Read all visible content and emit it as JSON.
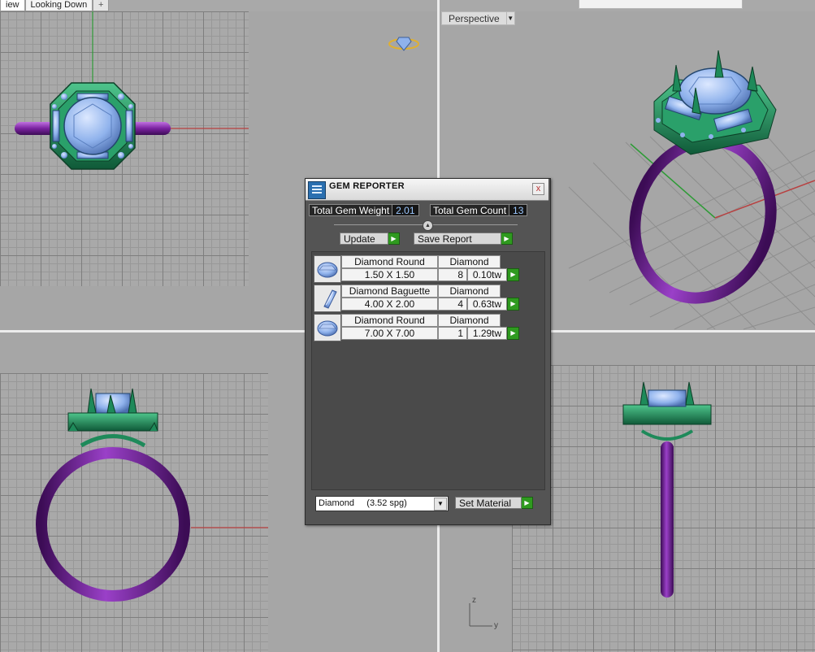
{
  "tabs": [
    {
      "label": "iew",
      "active": true
    },
    {
      "label": "Looking Down",
      "active": false
    }
  ],
  "add_tab_glyph": "+",
  "perspective_view": {
    "label": "Perspective",
    "dropdown_glyph": "▼"
  },
  "gem_reporter": {
    "title": "GEM REPORTER",
    "close_glyph": "x",
    "total_gem_weight": {
      "label": "Total Gem Weight",
      "value": "2.01"
    },
    "total_gem_count": {
      "label": "Total Gem Count",
      "value": "13"
    },
    "slider_glyph": "▲",
    "update_label": "Update",
    "save_report_label": "Save Report",
    "go_glyph": "▶",
    "gems": [
      {
        "shape": "Diamond Round",
        "size": "1.50 X 1.50",
        "material": "Diamond",
        "count": "8",
        "weight": "0.10tw",
        "icon": "round-gem-icon"
      },
      {
        "shape": "Diamond Baguette",
        "size": "4.00 X 2.00",
        "material": "Diamond",
        "count": "4",
        "weight": "0.63tw",
        "icon": "baguette-gem-icon"
      },
      {
        "shape": "Diamond Round",
        "size": "7.00 X 7.00",
        "material": "Diamond",
        "count": "1",
        "weight": "1.29tw",
        "icon": "round-gem-icon"
      }
    ],
    "material_select": {
      "value": "Diamond     (3.52 spg)",
      "dropdown_glyph": "▼"
    },
    "set_material_label": "Set Material"
  },
  "axis_labels": {
    "z": "z",
    "y": "y"
  },
  "colors": {
    "metal_purple": "#7a22a0",
    "setting_green": "#1e8a5a",
    "gem_blue": "#8fb2ec",
    "axis_red": "#b84040",
    "axis_green": "#2e9b36",
    "go_green": "#2f9a1f"
  }
}
